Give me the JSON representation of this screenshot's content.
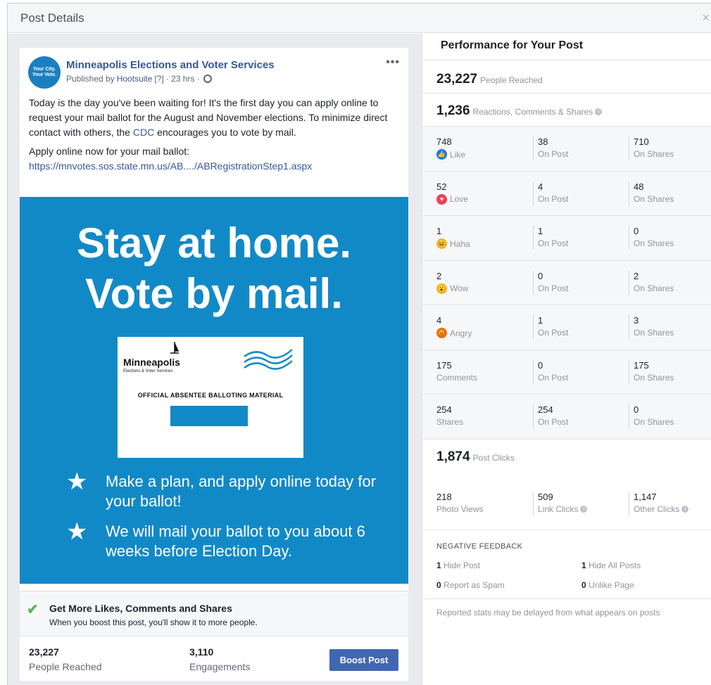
{
  "modal": {
    "title": "Post Details",
    "close": "×"
  },
  "post": {
    "page_name": "Minneapolis Elections and Voter Services",
    "avatar_text": "Your City. Your Vote.",
    "published_prefix": "Published by",
    "publisher": "Hootsuite",
    "help": "[?]",
    "time": "· 23 hrs ·",
    "more": "•••",
    "body_1a": "Today is the day you've been waiting for! It's the first day you can apply online to request your mail ballot for the August and November elections. To minimize direct contact with others, the ",
    "body_1_link": "CDC",
    "body_1b": " encourages you to vote by mail.",
    "body_2": "Apply online now for your mail ballot:",
    "url": "https://mnvotes.sos.state.mn.us/AB..../ABRegistrationStep1.aspx",
    "image": {
      "headline_1": "Stay at home.",
      "headline_2": "Vote by mail.",
      "ballot_logo": "Minneapolis",
      "ballot_sub": "Elections & Voter Services",
      "ballot_official": "OFFICIAL ABSENTEE BALLOTING MATERIAL",
      "bullet_1": "Make a plan, and apply online today for your ballot!",
      "bullet_2": "We will mail your ballot to you about 6 weeks before Election Day."
    },
    "boost": {
      "title": "Get More Likes, Comments and Shares",
      "subtitle": "When you boost this post, you'll show it to more people."
    },
    "footer": {
      "reached_value": "23,227",
      "reached_label": "People Reached",
      "engagements_value": "3,110",
      "engagements_label": "Engagements",
      "boost_button": "Boost Post"
    }
  },
  "performance": {
    "title": "Performance for Your Post",
    "people_reached": "23,227",
    "people_reached_label": "People Reached",
    "reactions_total": "1,236",
    "reactions_label": "Reactions, Comments & Shares",
    "rows": [
      {
        "total": "748",
        "label": "Like",
        "on_post": "38",
        "on_shares": "710"
      },
      {
        "total": "52",
        "label": "Love",
        "on_post": "4",
        "on_shares": "48"
      },
      {
        "total": "1",
        "label": "Haha",
        "on_post": "1",
        "on_shares": "0"
      },
      {
        "total": "2",
        "label": "Wow",
        "on_post": "0",
        "on_shares": "2"
      },
      {
        "total": "4",
        "label": "Angry",
        "on_post": "1",
        "on_shares": "3"
      },
      {
        "total": "175",
        "label": "Comments",
        "on_post": "0",
        "on_shares": "175"
      },
      {
        "total": "254",
        "label": "Shares",
        "on_post": "254",
        "on_shares": "0"
      }
    ],
    "on_post_label": "On Post",
    "on_shares_label": "On Shares",
    "post_clicks": "1,874",
    "post_clicks_label": "Post Clicks",
    "photo_views": "218",
    "photo_views_label": "Photo Views",
    "link_clicks": "509",
    "link_clicks_label": "Link Clicks",
    "other_clicks": "1,147",
    "other_clicks_label": "Other Clicks",
    "negative_title": "NEGATIVE FEEDBACK",
    "hide_post": "1",
    "hide_post_label": "Hide Post",
    "hide_all": "1",
    "hide_all_label": "Hide All Posts",
    "spam": "0",
    "spam_label": "Report as Spam",
    "unlike": "0",
    "unlike_label": "Unlike Page",
    "disclaimer": "Reported stats may be delayed from what appears on posts"
  },
  "colors": {
    "like": "#1877f2",
    "love": "#f33e58",
    "haha": "#f7b125",
    "wow": "#f7b125",
    "angry": "#e9710f"
  }
}
